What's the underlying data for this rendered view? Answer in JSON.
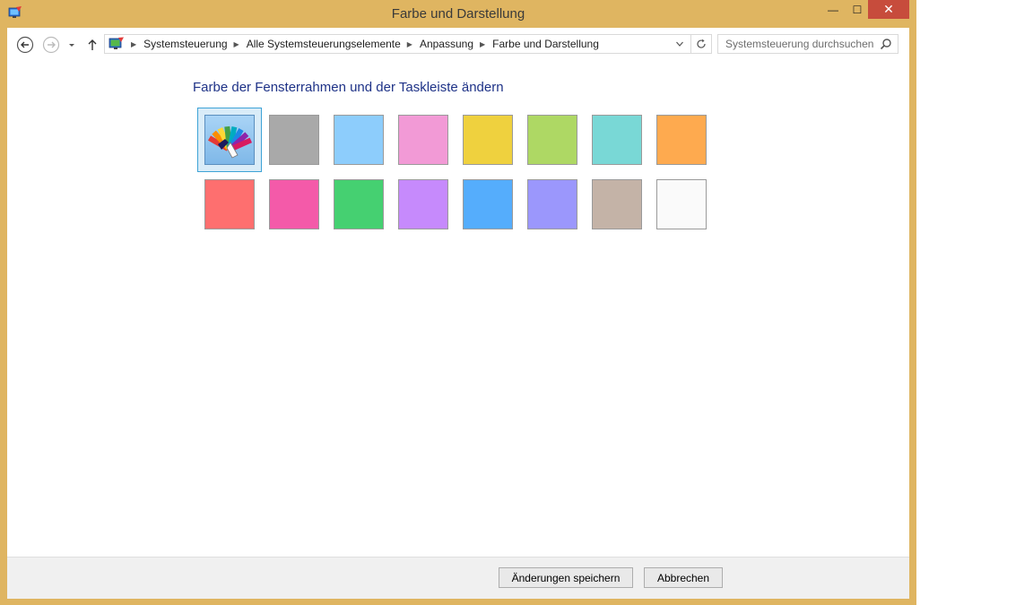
{
  "window": {
    "title": "Farbe und Darstellung",
    "minimize_label": "—",
    "maximize_label": "☐",
    "close_label": "✕",
    "frame_color": "#dfb561"
  },
  "navigation": {
    "back_icon": "back-arrow-icon",
    "forward_icon": "forward-arrow-icon",
    "up_icon": "up-arrow-icon",
    "breadcrumbs": [
      "Systemsteuerung",
      "Alle Systemsteuerungselemente",
      "Anpassung",
      "Farbe und Darstellung"
    ],
    "search_placeholder": "Systemsteuerung durchsuchen"
  },
  "main": {
    "heading": "Farbe der Fensterrahmen und der Taskleiste ändern",
    "swatches": [
      {
        "name": "color-mixer",
        "color": "#8fc5ef",
        "selected": true
      },
      {
        "name": "gray",
        "color": "#a9a9a9"
      },
      {
        "name": "light-blue",
        "color": "#8dcdfc"
      },
      {
        "name": "pink",
        "color": "#f29ad6"
      },
      {
        "name": "yellow",
        "color": "#efd13e"
      },
      {
        "name": "lime",
        "color": "#aed864"
      },
      {
        "name": "teal",
        "color": "#79d8d6"
      },
      {
        "name": "orange",
        "color": "#feaa4f"
      },
      {
        "name": "red",
        "color": "#fe6f6f"
      },
      {
        "name": "magenta",
        "color": "#f45aa9"
      },
      {
        "name": "green",
        "color": "#45d071"
      },
      {
        "name": "violet",
        "color": "#c68afc"
      },
      {
        "name": "blue",
        "color": "#55adfc"
      },
      {
        "name": "periwinkle",
        "color": "#9b97fc"
      },
      {
        "name": "taupe",
        "color": "#c4b3a7"
      },
      {
        "name": "white",
        "color": "#fafafa"
      }
    ]
  },
  "footer": {
    "save_label": "Änderungen speichern",
    "cancel_label": "Abbrechen"
  }
}
